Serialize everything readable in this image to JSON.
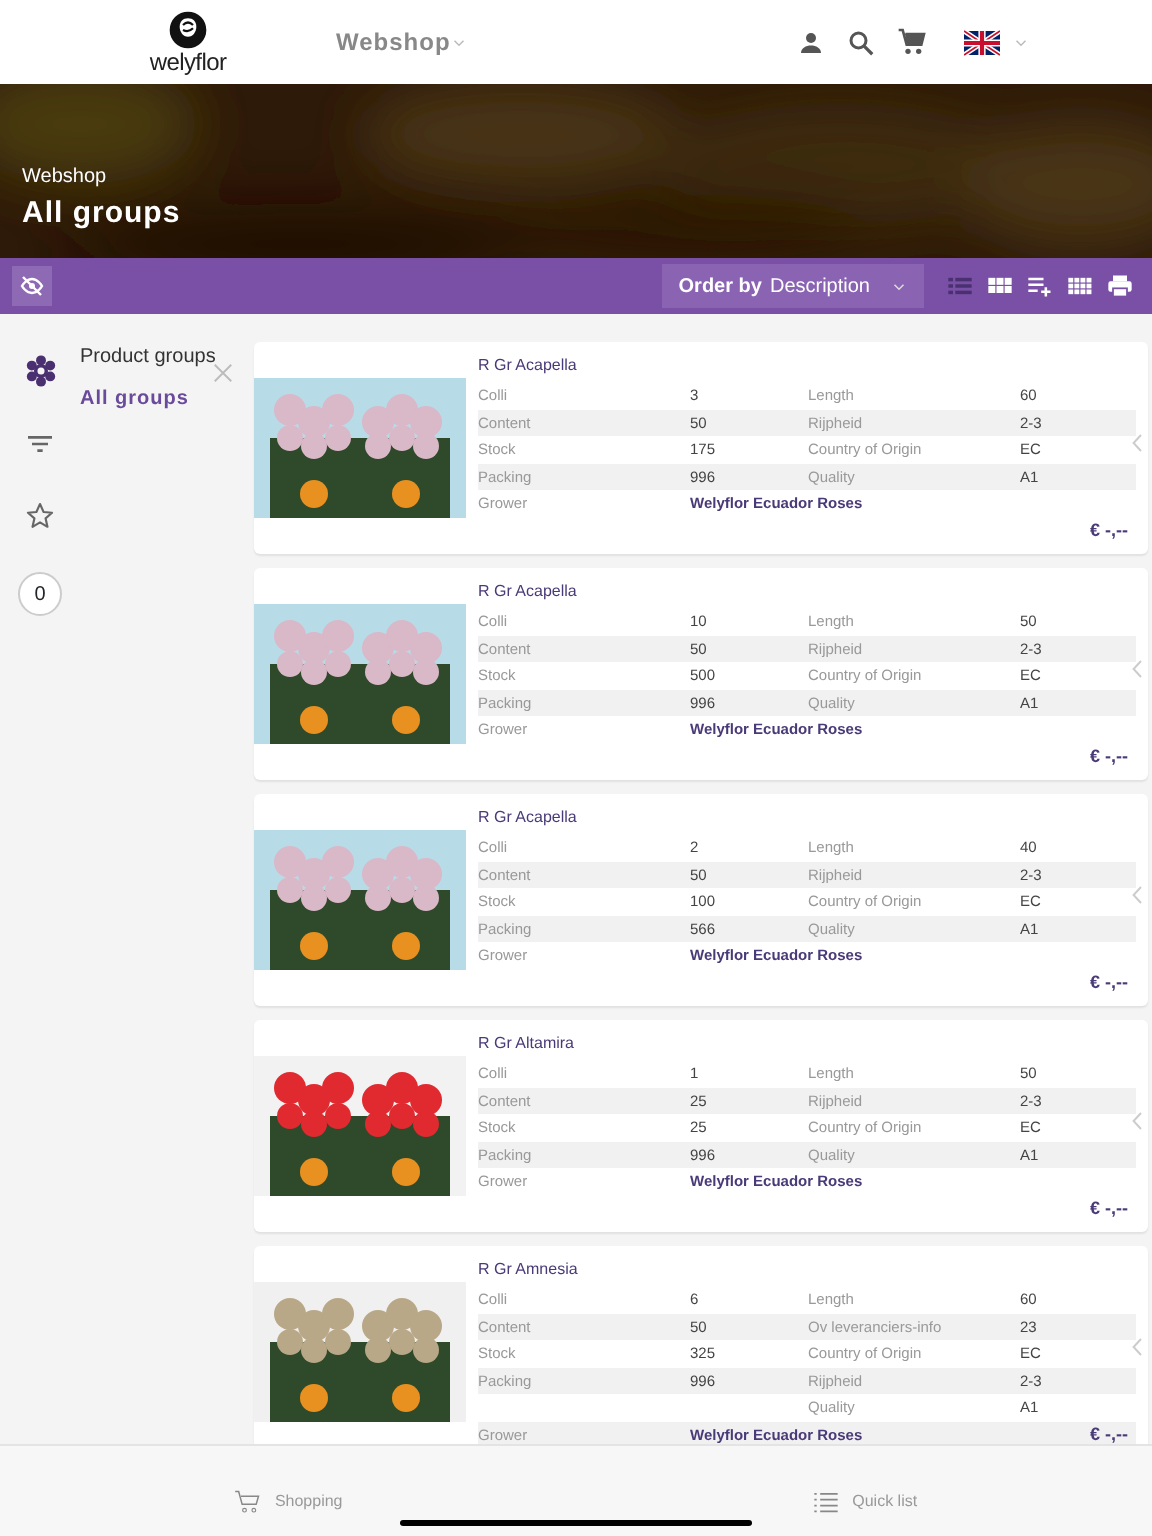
{
  "header": {
    "logo_text": "welyflor",
    "nav": "Webshop"
  },
  "hero": {
    "breadcrumb": "Webshop",
    "title": "All groups"
  },
  "toolbar": {
    "order_by_label": "Order by",
    "order_by_value": "Description",
    "views": [
      {
        "kind": "list",
        "selected": true
      },
      {
        "kind": "grid",
        "selected": false
      },
      {
        "kind": "playlist",
        "selected": false
      },
      {
        "kind": "grid-small",
        "selected": false
      },
      {
        "kind": "print",
        "selected": false
      }
    ]
  },
  "rail": {
    "count": "0"
  },
  "panel": {
    "title": "Product groups",
    "item": "All groups"
  },
  "products": [
    {
      "name": "R Gr Acapella",
      "price": "€ -,--",
      "rows": [
        {
          "label": "Colli",
          "value": "3",
          "label_2": "Length",
          "value_2": "60"
        },
        {
          "label": "Content",
          "value": "50",
          "label_2": "Rijpheid",
          "value_2": "2-3"
        },
        {
          "label": "Stock",
          "value": "175",
          "label_2": "Country of Origin",
          "value_2": "EC"
        },
        {
          "label": "Packing",
          "value": "996",
          "label_2": "Quality",
          "value_2": "A1"
        },
        {
          "label": "Grower",
          "value": "Welyflor Ecuador Roses",
          "kind": "grower"
        }
      ]
    },
    {
      "name": "R Gr Acapella",
      "price": "€ -,--",
      "rows": [
        {
          "label": "Colli",
          "value": "10",
          "label_2": "Length",
          "value_2": "50"
        },
        {
          "label": "Content",
          "value": "50",
          "label_2": "Rijpheid",
          "value_2": "2-3"
        },
        {
          "label": "Stock",
          "value": "500",
          "label_2": "Country of Origin",
          "value_2": "EC"
        },
        {
          "label": "Packing",
          "value": "996",
          "label_2": "Quality",
          "value_2": "A1"
        },
        {
          "label": "Grower",
          "value": "Welyflor Ecuador Roses",
          "kind": "grower"
        }
      ]
    },
    {
      "name": "R Gr Acapella",
      "price": "€ -,--",
      "rows": [
        {
          "label": "Colli",
          "value": "2",
          "label_2": "Length",
          "value_2": "40"
        },
        {
          "label": "Content",
          "value": "50",
          "label_2": "Rijpheid",
          "value_2": "2-3"
        },
        {
          "label": "Stock",
          "value": "100",
          "label_2": "Country of Origin",
          "value_2": "EC"
        },
        {
          "label": "Packing",
          "value": "566",
          "label_2": "Quality",
          "value_2": "A1"
        },
        {
          "label": "Grower",
          "value": "Welyflor Ecuador Roses",
          "kind": "grower"
        }
      ]
    },
    {
      "name": "R Gr Altamira",
      "price": "€ -,--",
      "rows": [
        {
          "label": "Colli",
          "value": "1",
          "label_2": "Length",
          "value_2": "50"
        },
        {
          "label": "Content",
          "value": "25",
          "label_2": "Rijpheid",
          "value_2": "2-3"
        },
        {
          "label": "Stock",
          "value": "25",
          "label_2": "Country of Origin",
          "value_2": "EC"
        },
        {
          "label": "Packing",
          "value": "996",
          "label_2": "Quality",
          "value_2": "A1"
        },
        {
          "label": "Grower",
          "value": "Welyflor Ecuador Roses",
          "kind": "grower"
        }
      ]
    },
    {
      "name": "R Gr Amnesia",
      "price": "€ -,--",
      "rows": [
        {
          "label": "Colli",
          "value": "6",
          "label_2": "Length",
          "value_2": "60"
        },
        {
          "label": "Content",
          "value": "50",
          "label_2": "Ov leveranciers-info",
          "value_2": "23"
        },
        {
          "label": "Stock",
          "value": "325",
          "label_2": "Country of Origin",
          "value_2": "EC"
        },
        {
          "label": "Packing",
          "value": "996",
          "label_2": "Rijpheid",
          "value_2": "2-3"
        },
        {
          "label_2": "Quality",
          "value_2": "A1"
        },
        {
          "label": "Grower",
          "value": "Welyflor Ecuador Roses",
          "kind": "grower"
        }
      ]
    }
  ],
  "bottom_nav": [
    {
      "kind": "cart",
      "label": "Shopping"
    },
    {
      "kind": "list",
      "label": "Quick list"
    }
  ]
}
